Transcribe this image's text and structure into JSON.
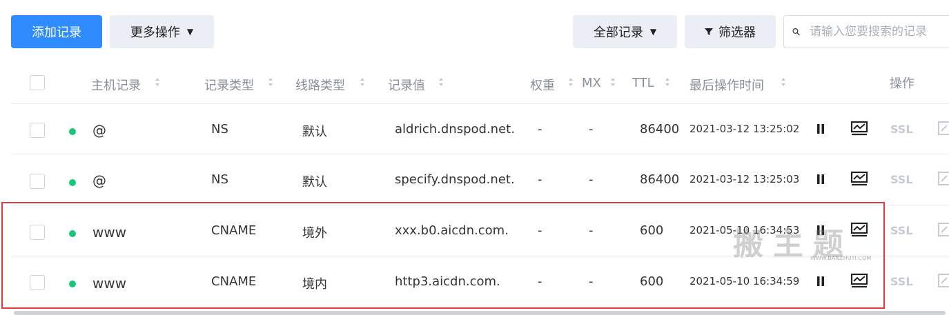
{
  "toolbar": {
    "add_label": "添加记录",
    "more_label": "更多操作",
    "all_label": "全部记录",
    "filter_label": "筛选器",
    "search_placeholder": "请输入您要搜索的记录"
  },
  "columns": {
    "host": "主机记录",
    "type": "记录类型",
    "line": "线路类型",
    "value": "记录值",
    "weight": "权重",
    "mx": "MX",
    "ttl": "TTL",
    "time": "最后操作时间",
    "actions": "操作"
  },
  "rows": [
    {
      "host": "@",
      "type": "NS",
      "line": "默认",
      "value": "aldrich.dnspod.net.",
      "weight": "-",
      "mx": "-",
      "ttl": "86400",
      "time": "2021-03-12 13:25:02",
      "ssl": "SSL"
    },
    {
      "host": "@",
      "type": "NS",
      "line": "默认",
      "value": "specify.dnspod.net.",
      "weight": "-",
      "mx": "-",
      "ttl": "86400",
      "time": "2021-03-12 13:25:03",
      "ssl": "SSL"
    },
    {
      "host": "www",
      "type": "CNAME",
      "line": "境外",
      "value": "xxx.b0.aicdn.com.",
      "weight": "-",
      "mx": "-",
      "ttl": "600",
      "time": "2021-05-10 16:34:53",
      "ssl": "SSL"
    },
    {
      "host": "www",
      "type": "CNAME",
      "line": "境内",
      "value": "http3.aicdn.com.",
      "weight": "-",
      "mx": "-",
      "ttl": "600",
      "time": "2021-05-10 16:34:59",
      "ssl": "SSL"
    }
  ],
  "watermark": {
    "text": "搬主题",
    "url": "WWW.BANZHUTI.COM"
  },
  "colors": {
    "primary": "#2f8cff",
    "status_dot": "#14c77b",
    "highlight_border": "#e03a3a"
  }
}
